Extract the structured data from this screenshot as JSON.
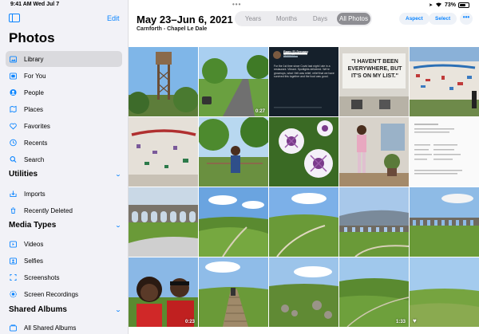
{
  "status": {
    "time": "9:41 AM",
    "date": "Wed Jul 7",
    "battery": "73%",
    "battery_level": 0.73
  },
  "sidebar": {
    "edit_label": "Edit",
    "title": "Photos",
    "library_items": [
      {
        "label": "Library",
        "icon": "photo-library-icon",
        "active": true
      },
      {
        "label": "For You",
        "icon": "for-you-icon"
      },
      {
        "label": "People",
        "icon": "people-icon"
      },
      {
        "label": "Places",
        "icon": "places-icon"
      },
      {
        "label": "Favorites",
        "icon": "heart-icon"
      },
      {
        "label": "Recents",
        "icon": "clock-icon"
      },
      {
        "label": "Search",
        "icon": "search-icon"
      }
    ],
    "utilities": {
      "title": "Utilities",
      "items": [
        {
          "label": "Imports",
          "icon": "import-icon"
        },
        {
          "label": "Recently Deleted",
          "icon": "trash-icon"
        }
      ]
    },
    "media_types": {
      "title": "Media Types",
      "items": [
        {
          "label": "Videos",
          "icon": "video-icon"
        },
        {
          "label": "Selfies",
          "icon": "selfie-icon"
        },
        {
          "label": "Screenshots",
          "icon": "screenshot-icon"
        },
        {
          "label": "Screen Recordings",
          "icon": "screen-recording-icon"
        }
      ]
    },
    "shared_albums": {
      "title": "Shared Albums",
      "items": [
        {
          "label": "All Shared Albums",
          "icon": "shared-album-icon"
        }
      ]
    }
  },
  "main": {
    "title": "May 23–Jun 6, 2021",
    "subtitle": "Carnforth - Chapel Le Dale",
    "segments": [
      "Years",
      "Months",
      "Days",
      "All Photos"
    ],
    "active_segment": "All Photos",
    "aspect_label": "Aspect",
    "select_label": "Select",
    "more_label": "•••",
    "photos": [
      {
        "kind": "water-tower",
        "duration": ""
      },
      {
        "kind": "bike-path",
        "duration": "0:27"
      },
      {
        "kind": "tweet",
        "duration": "",
        "author": "Ramy El-Sergany",
        "handle": "@ramy23",
        "text": "For the 1st time since Covid last night I ate in a restaurant. Vibrant. Spotlights delivered. We're grownups, what I felt was relief, relief that we have survived this together and the food was good."
      },
      {
        "kind": "sign-display",
        "duration": "",
        "sign": "\"I HAVEN'T BEEN EVERYWHERE, BUT IT'S ON MY LIST.\""
      },
      {
        "kind": "wall-graffiti",
        "duration": ""
      },
      {
        "kind": "wall-graffiti-2",
        "duration": ""
      },
      {
        "kind": "child-trees",
        "duration": ""
      },
      {
        "kind": "petunias",
        "duration": ""
      },
      {
        "kind": "child-indoor",
        "duration": ""
      },
      {
        "kind": "document-screenshot",
        "duration": ""
      },
      {
        "kind": "viaduct",
        "duration": ""
      },
      {
        "kind": "valley",
        "duration": ""
      },
      {
        "kind": "hills-path",
        "duration": ""
      },
      {
        "kind": "viaduct-far",
        "duration": ""
      },
      {
        "kind": "viaduct-wide",
        "duration": ""
      },
      {
        "kind": "selfie",
        "duration": "0:23"
      },
      {
        "kind": "boardwalk",
        "duration": ""
      },
      {
        "kind": "moor",
        "duration": ""
      },
      {
        "kind": "green-field",
        "duration": "1:33"
      },
      {
        "kind": "field-heart",
        "duration": "",
        "favorite": true
      }
    ]
  },
  "colors": {
    "accent": "#0a84ff",
    "sidebar_bg": "#f2f2f7"
  }
}
